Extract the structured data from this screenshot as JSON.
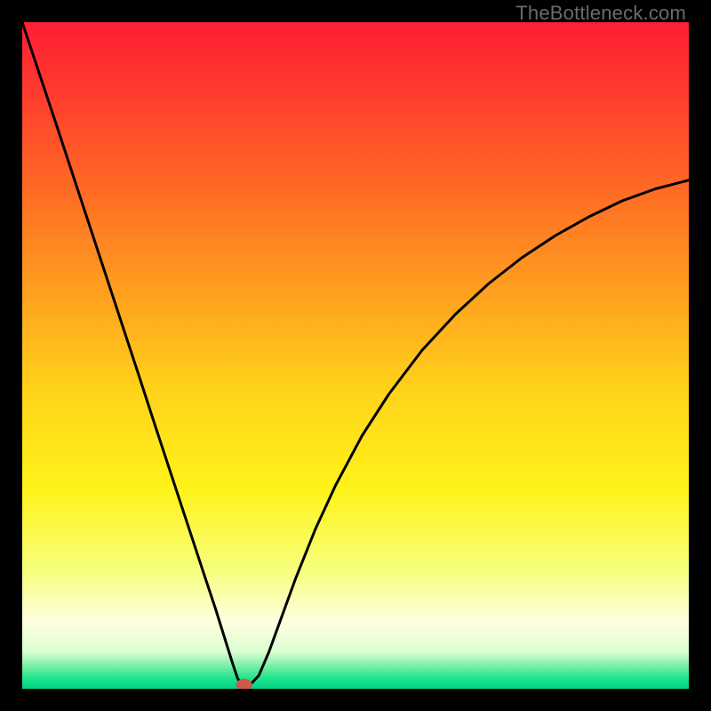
{
  "watermark": "TheBottleneck.com",
  "chart_data": {
    "type": "line",
    "title": "",
    "xlabel": "",
    "ylabel": "",
    "xlim": [
      0,
      100
    ],
    "ylim": [
      0,
      100
    ],
    "grid": false,
    "legend": false,
    "gradient_stops": [
      {
        "offset": 0.0,
        "color": "#ff1e33"
      },
      {
        "offset": 0.1,
        "color": "#ff3a2f"
      },
      {
        "offset": 0.25,
        "color": "#ff6a24"
      },
      {
        "offset": 0.4,
        "color": "#ff9e1f"
      },
      {
        "offset": 0.55,
        "color": "#ffd21a"
      },
      {
        "offset": 0.7,
        "color": "#fff319"
      },
      {
        "offset": 0.82,
        "color": "#f7ff7a"
      },
      {
        "offset": 0.9,
        "color": "#ffffe0"
      },
      {
        "offset": 0.945,
        "color": "#d8ffd0"
      },
      {
        "offset": 0.965,
        "color": "#7cf0a8"
      },
      {
        "offset": 0.985,
        "color": "#1de38d"
      },
      {
        "offset": 1.0,
        "color": "#00d184"
      }
    ],
    "series": [
      {
        "name": "bottleneck-curve",
        "stroke": "#000000",
        "x": [
          0.0,
          2.5,
          5.0,
          7.5,
          10.0,
          12.5,
          15.0,
          17.5,
          20.0,
          22.5,
          25.0,
          27.5,
          29.0,
          30.5,
          31.5,
          32.3,
          33.0,
          34.0,
          35.5,
          37.0,
          39.0,
          41.0,
          44.0,
          47.0,
          51.0,
          55.0,
          60.0,
          65.0,
          70.0,
          75.0,
          80.0,
          85.0,
          90.0,
          95.0,
          100.0
        ],
        "values": [
          100.0,
          92.5,
          85.0,
          77.4,
          69.8,
          62.2,
          54.6,
          47.0,
          39.3,
          31.7,
          24.1,
          16.5,
          12.0,
          7.2,
          4.0,
          1.6,
          0.4,
          0.4,
          2.0,
          5.5,
          11.0,
          16.5,
          24.0,
          30.5,
          38.0,
          44.2,
          50.8,
          56.2,
          60.8,
          64.7,
          68.0,
          70.8,
          73.2,
          75.0,
          76.3
        ]
      }
    ],
    "marker": {
      "x": 33.3,
      "y": 0.6,
      "color": "#cc5a4a",
      "rx": 1.2,
      "ry": 0.9
    }
  }
}
